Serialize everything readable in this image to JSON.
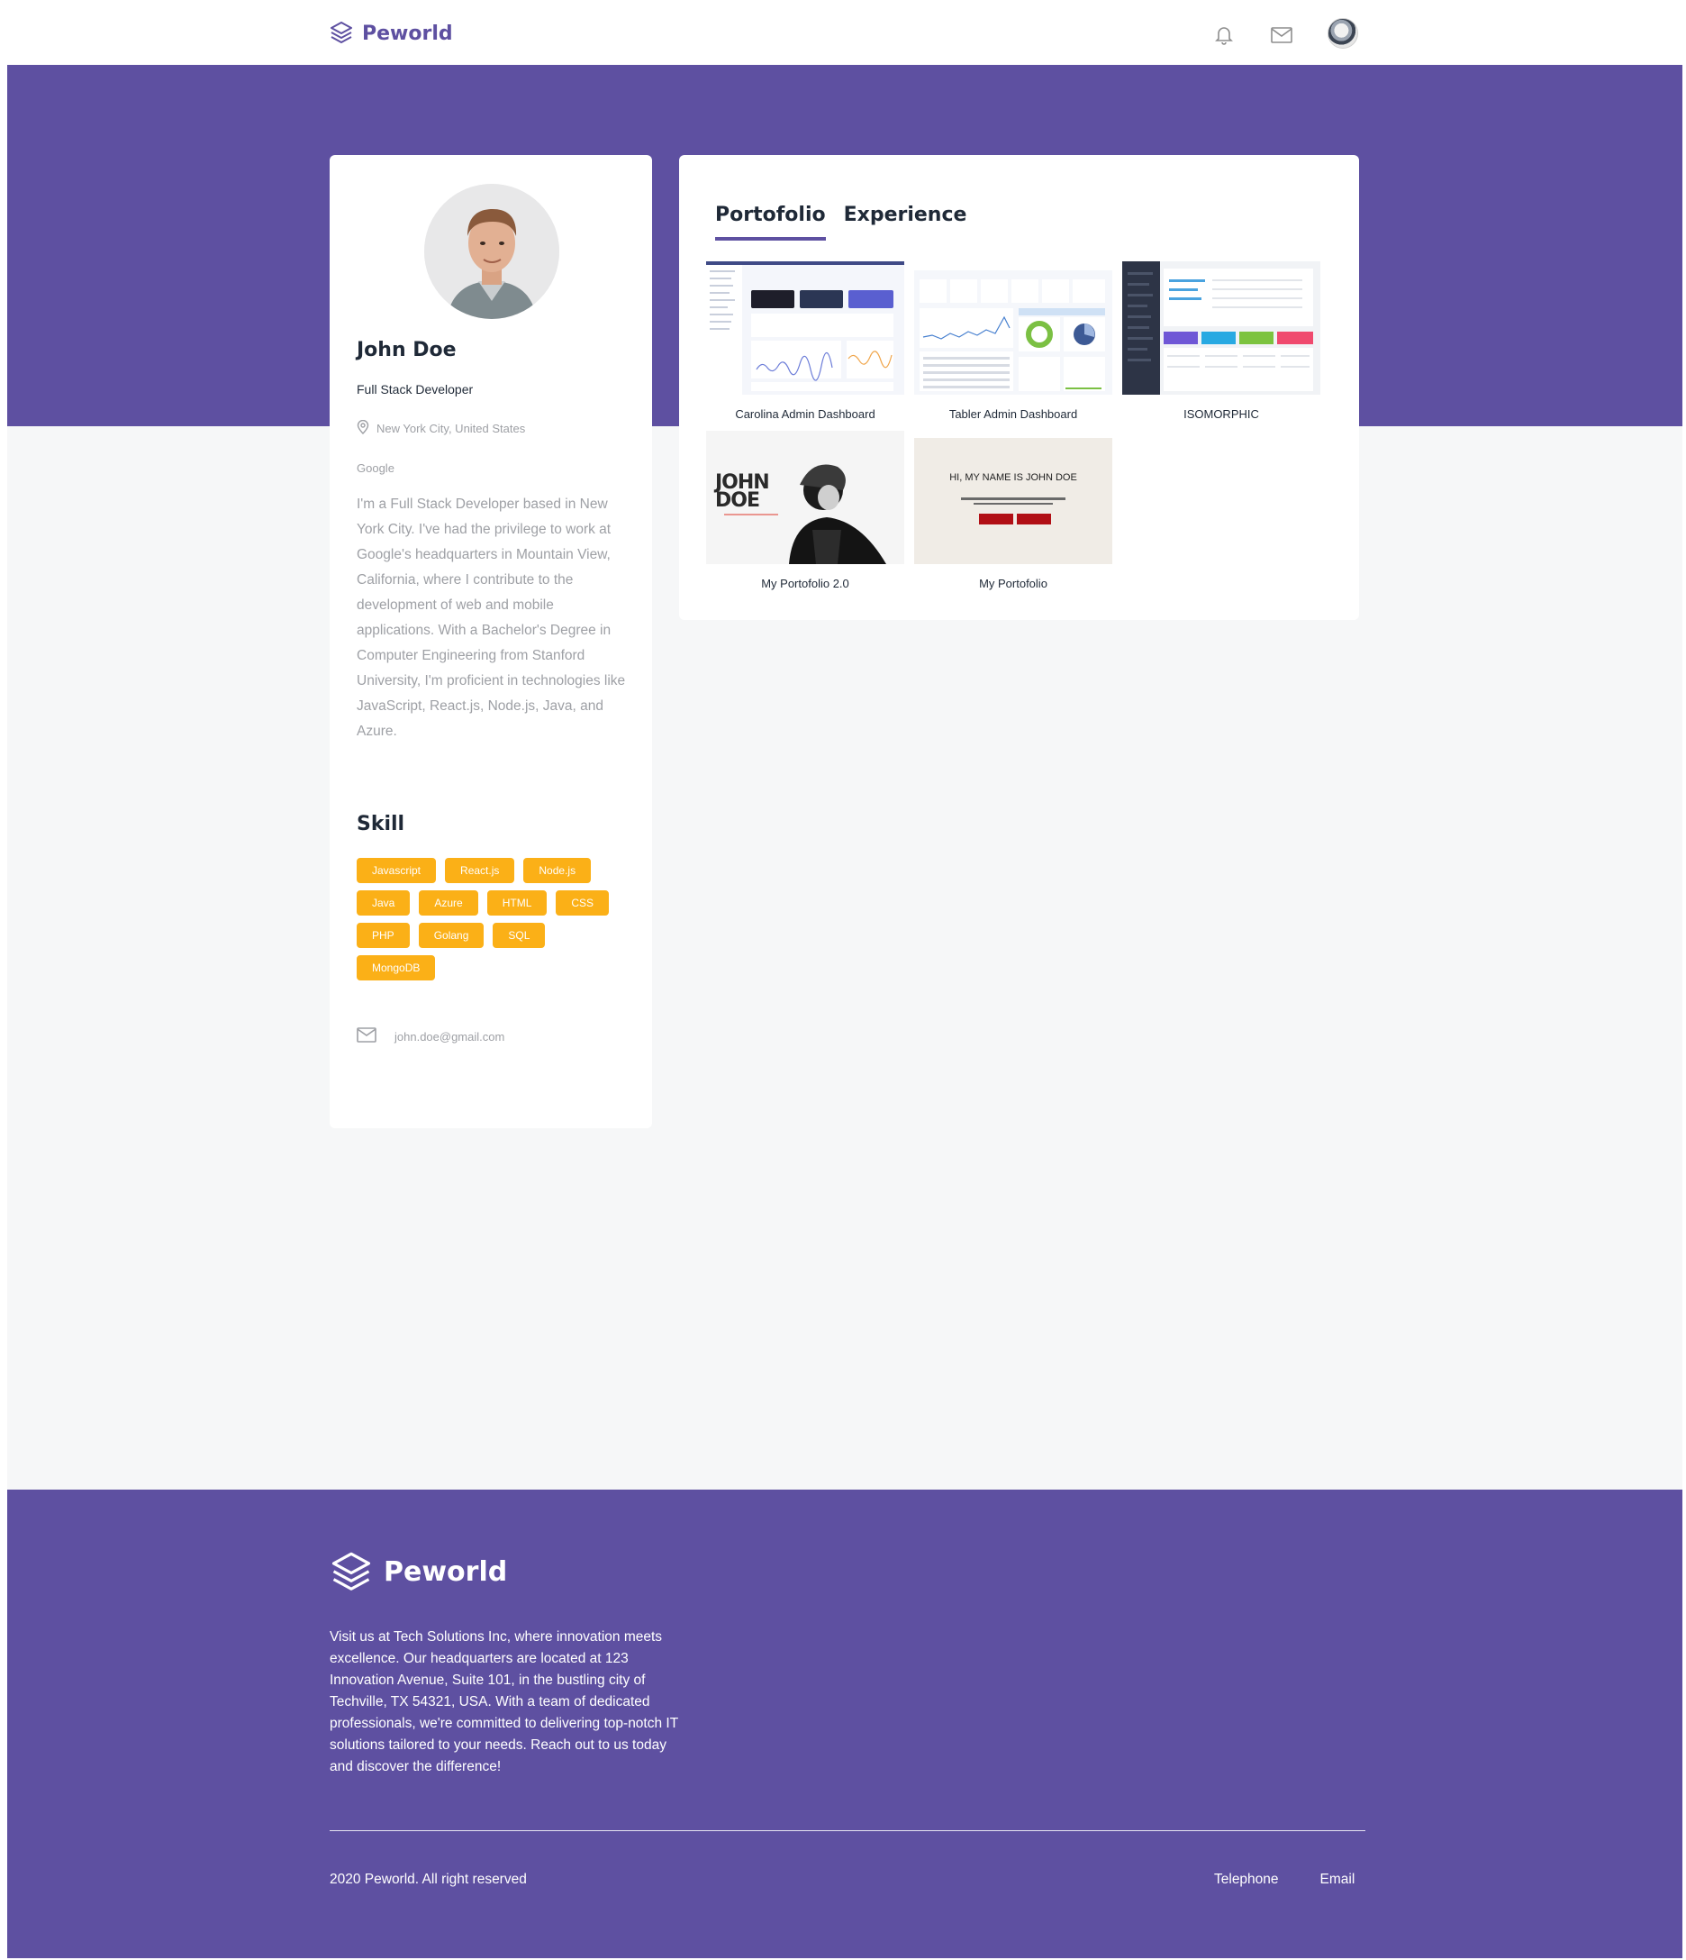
{
  "navbar": {
    "brand": "Peworld",
    "icons": [
      "bell-icon",
      "mail-icon",
      "avatar"
    ]
  },
  "profile": {
    "name": "John Doe",
    "job": "Full Stack Developer",
    "location": "New York City, United States",
    "company": "Google",
    "bio": "I'm a Full Stack Developer based in New York City. I've had the privilege to work at Google's headquarters in Mountain View, California, where I contribute to the development of web and mobile applications. With a Bachelor's Degree in Computer Engineering from Stanford University, I'm proficient in technologies like JavaScript, React.js, Node.js, Java, and Azure.",
    "skill_title": "Skill",
    "skills": [
      "Javascript",
      "React.js",
      "Node.js",
      "Java",
      "Azure",
      "HTML",
      "CSS",
      "PHP",
      "Golang",
      "SQL",
      "MongoDB"
    ],
    "email": "john.doe@gmail.com"
  },
  "portfolio": {
    "tabs": [
      "Portofolio",
      "Experience"
    ],
    "active_tab": "Portofolio",
    "items": [
      {
        "title": "Carolina Admin Dashboard"
      },
      {
        "title": "Tabler Admin Dashboard"
      },
      {
        "title": "ISOMORPHIC"
      },
      {
        "title": "My Portofolio 2.0",
        "thumb_text": "JOHN DOE"
      },
      {
        "title": "My Portofolio",
        "thumb_text": "HI, MY NAME IS JOHN DOE"
      }
    ]
  },
  "footer": {
    "brand": "Peworld",
    "description": "Visit us at Tech Solutions Inc, where innovation meets excellence. Our headquarters are located at 123 Innovation Avenue, Suite 101, in the bustling city of Techville, TX 54321, USA. With a team of dedicated professionals, we're committed to delivering top-notch IT solutions tailored to your needs. Reach out to us today and discover the difference!",
    "copyright": "2020 Peworld. All right reserved",
    "links": [
      "Telephone",
      "Email"
    ]
  },
  "colors": {
    "primary": "#5e50a1",
    "skill_badge": "#fbb017",
    "background": "#f6f7f8",
    "muted_text": "#9ea0a5"
  }
}
